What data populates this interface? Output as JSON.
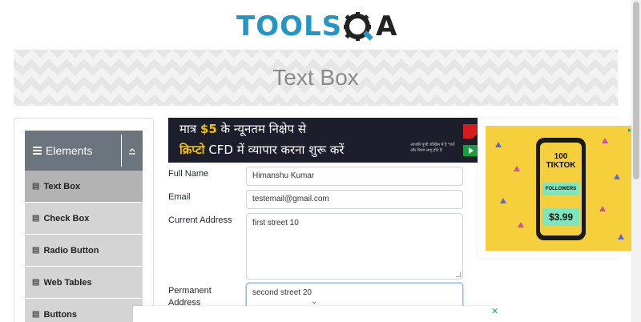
{
  "header": {
    "logo_text": "TOOLS",
    "logo_suffix": "A"
  },
  "banner": {
    "title": "Text Box"
  },
  "sidebar": {
    "group_title": "Elements",
    "items": [
      {
        "label": "Text Box",
        "icon": "document-icon",
        "active": true
      },
      {
        "label": "Check Box",
        "icon": "document-icon"
      },
      {
        "label": "Radio Button",
        "icon": "document-icon"
      },
      {
        "label": "Web Tables",
        "icon": "document-icon"
      },
      {
        "label": "Buttons",
        "icon": "document-icon"
      }
    ]
  },
  "ad_top": {
    "line1_pre": "मात्र ",
    "line1_amount": "$5",
    "line1_post": " के न्यूनतम निक्षेप से",
    "line2_brand": "क्रिप्टो",
    "line2_post": " CFD में  व्यापार करना शुरू करें",
    "small_print": "आपकी पूंजी जोखिम में है *शर्तें और नियम लागू होते हैं"
  },
  "form": {
    "full_name_label": "Full Name",
    "full_name_value": "Himanshu Kumar",
    "email_label": "Email",
    "email_value": "testemail@gmail.com",
    "current_address_label": "Current Address",
    "current_address_value": "first street 10",
    "permanent_address_label": "Permanent Address",
    "permanent_address_value": "second street 20"
  },
  "ad_right": {
    "count": "100",
    "platform": "TIKTOK",
    "followers": "FOLLOWERS",
    "price": "$3.99"
  },
  "colors": {
    "brand_blue": "#2196c7",
    "sidebar_header": "#6c757d",
    "ad_yellow": "#f5cf3c"
  }
}
